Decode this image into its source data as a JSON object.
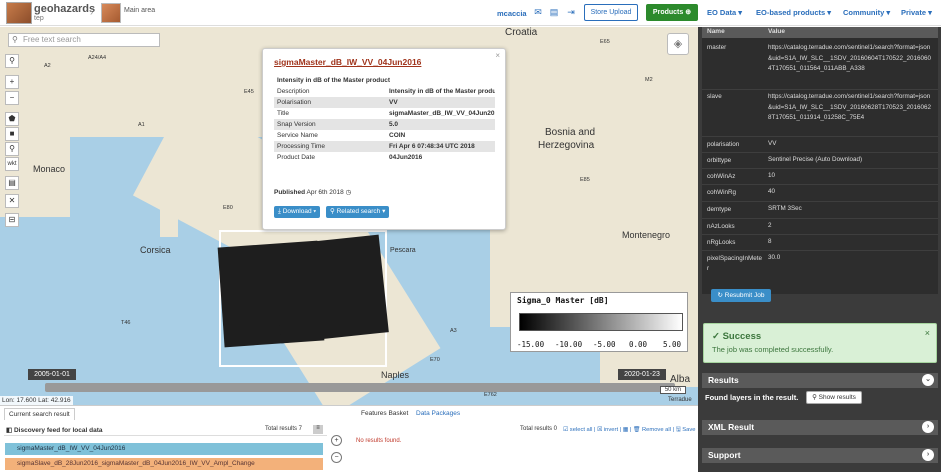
{
  "header": {
    "brand": "geohazards",
    "brand_sub": "tep",
    "crumb": "Main area",
    "user": "mcaccia",
    "store_upload": "Store Upload",
    "products": "Products",
    "menus": [
      "EO Data ▾",
      "EO-based products ▾",
      "Community ▾",
      "Private ▾"
    ],
    "brand_color": "#2c8a2c",
    "link_color": "#2a6ebb"
  },
  "map": {
    "search_placeholder": "Free text search",
    "tools": [
      "+",
      "−",
      "⬟",
      "■",
      "⚲",
      "wkt",
      "▤",
      "✕",
      "⊟"
    ],
    "labels": [
      "Croatia",
      "Bosnia and",
      "Herzegovina",
      "Montenegro",
      "Monaco",
      "Corsica",
      "Naples",
      "Alba",
      "Pescara"
    ],
    "road_labels": [
      "A24/A4",
      "A2",
      "A1",
      "E80",
      "E45",
      "T46",
      "A3",
      "E65",
      "E762",
      "E85",
      "E70",
      "M2"
    ],
    "coords": "Lon: 17.600 Lat: 42.916",
    "timeline_start": "2005-01-01",
    "timeline_end": "2020-01-23",
    "scale": "50 km",
    "attribution": "Terradue",
    "legend": {
      "title": "Sigma_0 Master [dB]",
      "ticks": [
        "-15.00",
        "-10.00",
        "-5.00",
        "0.00",
        "5.00"
      ]
    }
  },
  "popup": {
    "title": "sigmaMaster_dB_IW_VV_04Jun2016",
    "heading": "Intensity in dB of the Master product",
    "rows": [
      {
        "k": "Description",
        "v": "Intensity in dB of the Master product"
      },
      {
        "k": "Polarisation",
        "v": "VV"
      },
      {
        "k": "Title",
        "v": "sigmaMaster_dB_IW_VV_04Jun2016"
      },
      {
        "k": "Snap Version",
        "v": "5.0"
      },
      {
        "k": "Service Name",
        "v": "COIN"
      },
      {
        "k": "Processing Time",
        "v": "Fri Apr 6 07:48:34 UTC 2018"
      },
      {
        "k": "Product Date",
        "v": "04Jun2016"
      }
    ],
    "published_label": "Published",
    "published_date": "Apr 6th 2018",
    "download": "Download ▾",
    "related": "Related search ▾"
  },
  "bottom": {
    "tab_current": "Current search result",
    "feed_title": "Discovery feed for local data",
    "total_left": "Total results 7",
    "item_a": "sigmaMaster_dB_IW_VV_04Jun2016",
    "item_b": "sigmaSlave_dB_28Jun2016_sigmaMaster_dB_04Jun2016_IW_VV_Ampl_Change",
    "tab_basket": "Features Basket",
    "tab_packages": "Data Packages",
    "total_right": "Total results 0",
    "basket_tools": "☑ select all | ☒ invert | ▦ | 🗑 Remove all | 🖫 Save",
    "no_results": "No results found."
  },
  "props": {
    "head_name": "Name",
    "head_value": "Value",
    "rows": [
      {
        "k": "master",
        "v": "https://catalog.terradue.com/sentinel1/search?format=json&uid=S1A_IW_SLC__1SDV_20160604T170522_20160604T170551_011564_011ABB_A338"
      },
      {
        "k": "slave",
        "v": "https://catalog.terradue.com/sentinel1/search?format=json&uid=S1A_IW_SLC__1SDV_20160628T170523_20160628T170551_011914_01258C_75E4"
      },
      {
        "k": "polarisation",
        "v": "VV"
      },
      {
        "k": "orbittype",
        "v": "Sentinel Precise (Auto Download)"
      },
      {
        "k": "cohWinAz",
        "v": "10"
      },
      {
        "k": "cohWinRg",
        "v": "40"
      },
      {
        "k": "demtype",
        "v": "SRTM 3Sec"
      },
      {
        "k": "nAzLooks",
        "v": "2"
      },
      {
        "k": "nRgLooks",
        "v": "8"
      },
      {
        "k": "pixelSpacingInMeter",
        "v": "30.0"
      }
    ],
    "resubmit": "↻ Resubmit Job"
  },
  "status": {
    "success_title": "✓ Success",
    "success_msg": "The job was completed successfully."
  },
  "sections": {
    "results": "Results",
    "found": "Found layers in the result.",
    "show_results": "⚲ Show results",
    "xml": "XML Result",
    "support": "Support"
  }
}
